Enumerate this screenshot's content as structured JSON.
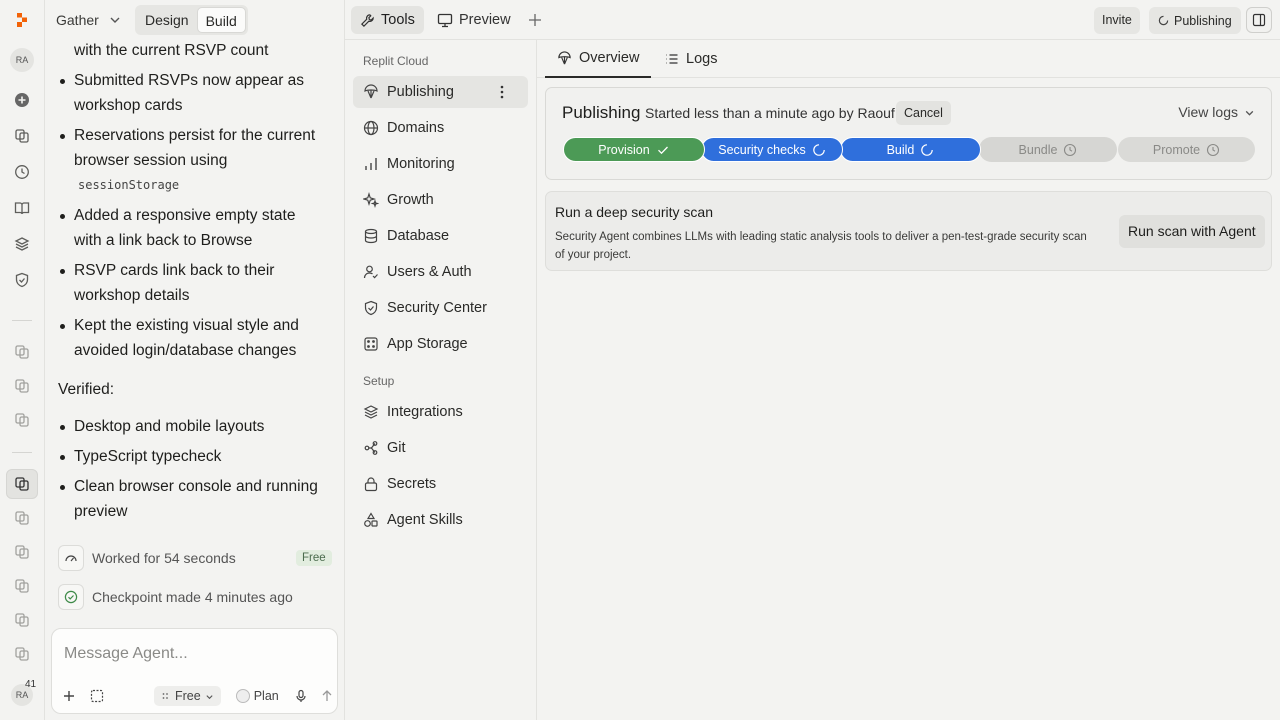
{
  "colors": {
    "brand": "#f26207",
    "success": "#4c9a56",
    "progress": "#2f6fdc"
  },
  "project": {
    "name": "Gather"
  },
  "mode_toggle": {
    "design": "Design",
    "build": "Build"
  },
  "rail": {
    "avatar": "RA",
    "notification_count": "41"
  },
  "chat": {
    "line_top": "with the current RSVP count",
    "bullets_a": [
      {
        "l1": "Submitted RSVPs now appear as",
        "l2": "workshop cards"
      },
      {
        "l1": "Reservations persist for the current",
        "l2": "browser session using",
        "code": "sessionStorage"
      },
      {
        "l1": "Added a responsive empty state",
        "l2": "with a link back to Browse"
      },
      {
        "l1": "RSVP cards link back to their",
        "l2": "workshop details"
      },
      {
        "l1": "Kept the existing visual style and",
        "l2": "avoided login/database changes"
      }
    ],
    "verified_label": "Verified:",
    "bullets_b": [
      {
        "l1": "Desktop and mobile layouts"
      },
      {
        "l1": "TypeScript typecheck"
      },
      {
        "l1": "Clean browser console and running",
        "l2": "preview"
      }
    ],
    "worked": "Worked for 54 seconds",
    "free_badge": "Free",
    "checkpoint": "Checkpoint made 4 minutes ago",
    "composer_placeholder": "Message Agent...",
    "composer_free": "Free",
    "composer_plan": "Plan"
  },
  "tools_header": {
    "tools_tab": "Tools",
    "preview_tab": "Preview",
    "invite": "Invite",
    "publishing": "Publishing"
  },
  "nav": {
    "section_cloud": "Replit Cloud",
    "items_cloud": [
      "Publishing",
      "Domains",
      "Monitoring",
      "Growth",
      "Database",
      "Users & Auth",
      "Security Center",
      "App Storage"
    ],
    "section_setup": "Setup",
    "items_setup": [
      "Integrations",
      "Git",
      "Secrets",
      "Agent Skills"
    ]
  },
  "main": {
    "tab_overview": "Overview",
    "tab_logs": "Logs",
    "publishing_title": "Publishing",
    "publishing_status": "Started less than a minute ago by Raouf",
    "cancel": "Cancel",
    "view_logs": "View logs",
    "stages": [
      {
        "label": "Provision",
        "state": "done"
      },
      {
        "label": "Security checks",
        "state": "running"
      },
      {
        "label": "Build",
        "state": "running"
      },
      {
        "label": "Bundle",
        "state": "pending"
      },
      {
        "label": "Promote",
        "state": "pending"
      }
    ],
    "scan_title": "Run a deep security scan",
    "scan_desc": "Security Agent combines LLMs with leading static analysis tools to deliver a pen-test-grade security scan of your project.",
    "scan_button": "Run scan with Agent"
  }
}
